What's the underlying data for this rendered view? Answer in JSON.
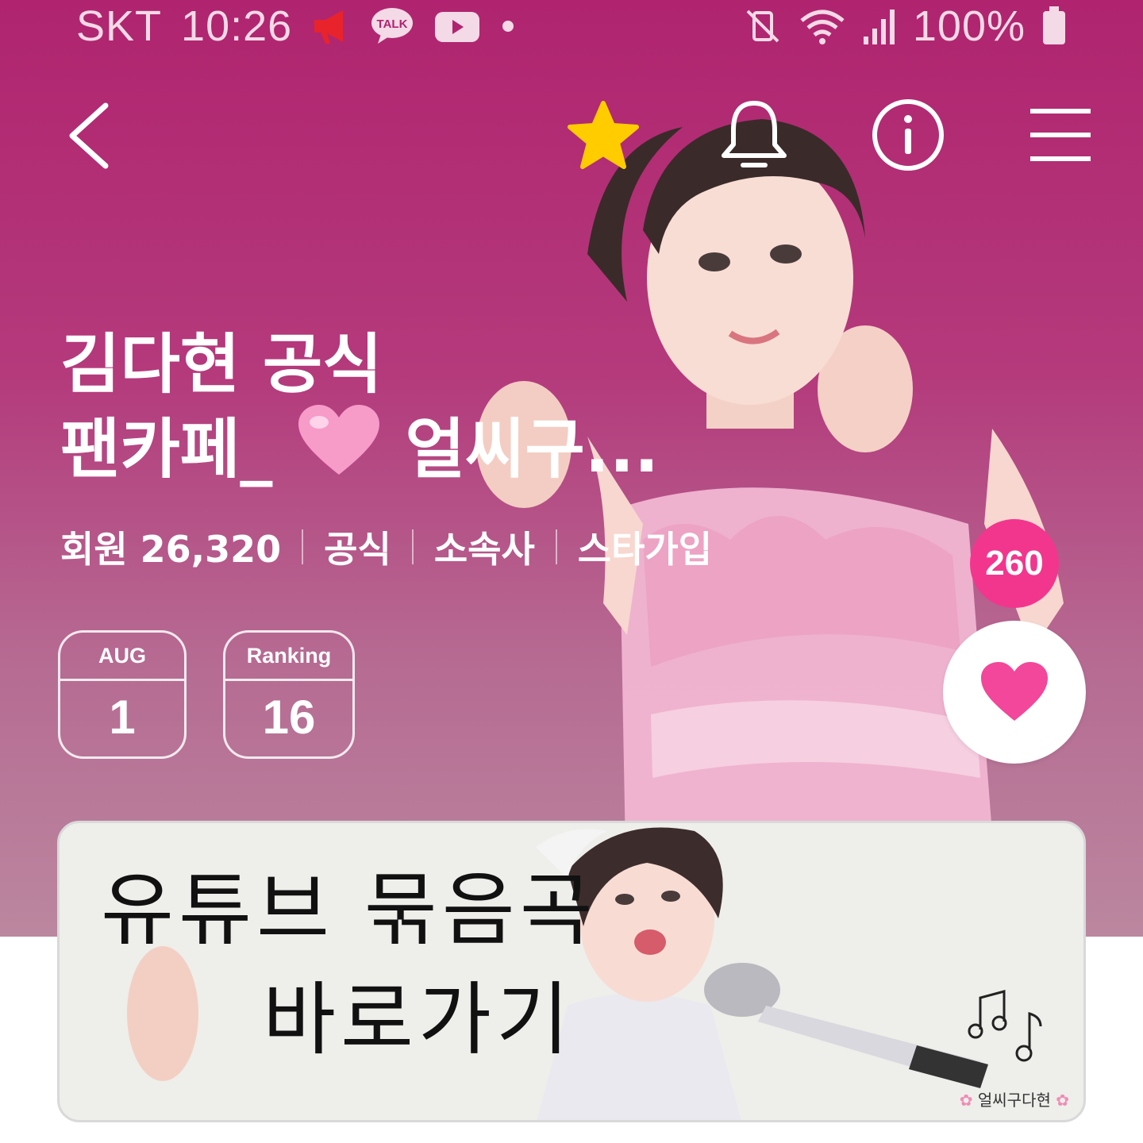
{
  "status_bar": {
    "carrier": "SKT",
    "time": "10:26",
    "battery": "100%",
    "notification_icons": [
      "megaphone-icon",
      "kakaotalk-icon",
      "youtube-icon"
    ]
  },
  "nav": {
    "back_icon": "chevron-left-icon",
    "favorite_icon": "star-icon",
    "bell_icon": "bell-icon",
    "info_icon": "info-icon",
    "menu_icon": "hamburger-menu-icon"
  },
  "cafe": {
    "title_line1": "김다현 공식",
    "title_line2_prefix": "팬카페_ ",
    "title_line2_suffix": "얼씨구...",
    "members": "회원 26,320",
    "tags": [
      "공식",
      "소속사",
      "스타가입"
    ]
  },
  "cards": {
    "month_label": "AUG",
    "day": "1",
    "ranking_label": "Ranking",
    "ranking_value": "16"
  },
  "like": {
    "count": "260"
  },
  "banner": {
    "line1": "유튜브 묶음곡",
    "line2": "바로가기",
    "credit": "얼씨구다현"
  },
  "colors": {
    "header_top": "#b0246f",
    "header_bottom": "#bb879f",
    "star": "#ffcc00",
    "badge": "#f2368e",
    "heart": "#f2479a"
  }
}
